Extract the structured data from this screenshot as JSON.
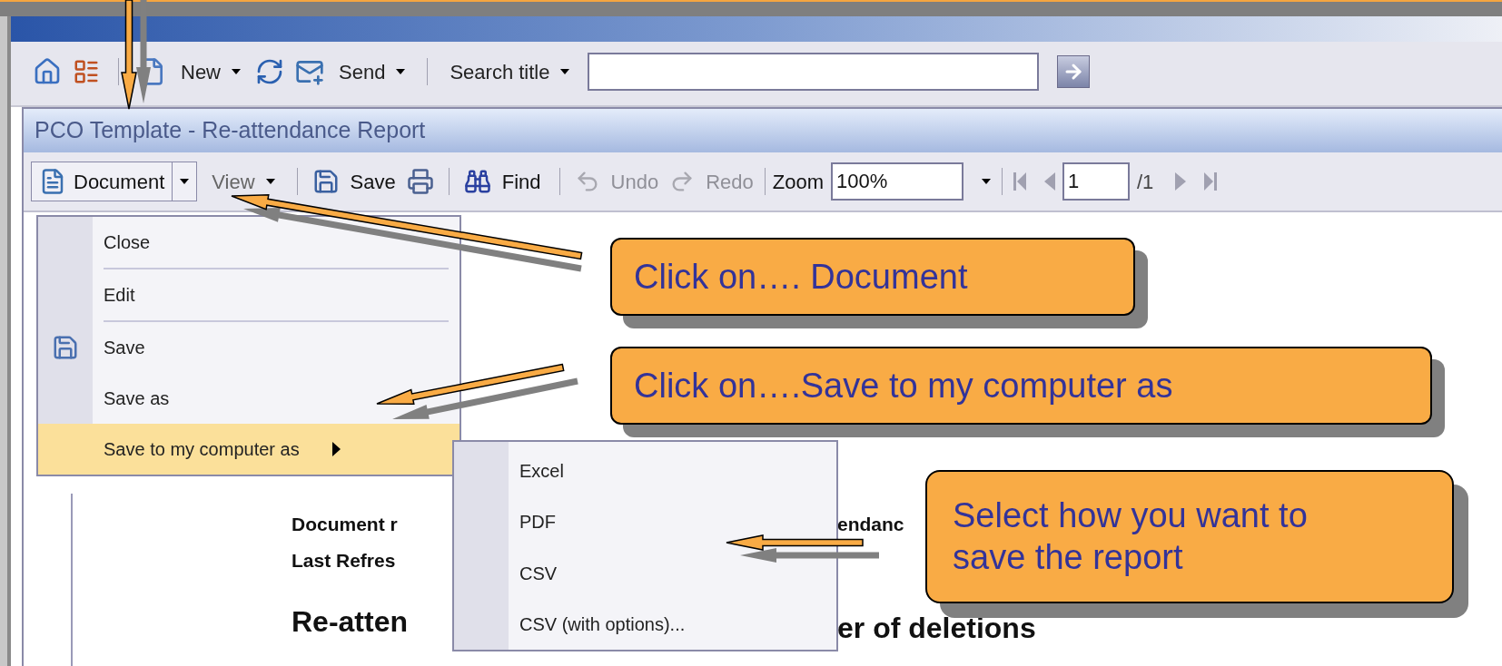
{
  "toolbar": {
    "new": "New",
    "send": "Send",
    "search_label": "Search title"
  },
  "report_window": {
    "title": "PCO Template - Re-attendance Report",
    "toolbar": {
      "document": {
        "label": "Document",
        "open": true
      },
      "view": "View",
      "save": "Save",
      "find": "Find",
      "undo": {
        "label": "Undo",
        "disabled": true
      },
      "redo": {
        "label": "Redo",
        "disabled": true
      },
      "zoom_label": "Zoom",
      "zoom_value": "100%",
      "page_value": "1",
      "page_total": "/1"
    },
    "report": {
      "left": [
        "Document r",
        "Last Refres"
      ],
      "heading_left": "Re-atten",
      "right": "endanc",
      "heading_right": "er of deletions"
    }
  },
  "document_menu": [
    {
      "label": "Close",
      "kind": "plain",
      "selected": false,
      "divider_after": true,
      "submenu": false
    },
    {
      "label": "Edit",
      "kind": "plain",
      "selected": false,
      "divider_after": true,
      "submenu": false
    },
    {
      "label": "Save",
      "kind": "with_icon",
      "selected": false,
      "divider_after": false,
      "submenu": false
    },
    {
      "label": "Save as",
      "kind": "plain",
      "selected": false,
      "divider_after": false,
      "submenu": false
    },
    {
      "label": "Save to my computer as",
      "kind": "plain",
      "selected": true,
      "divider_after": false,
      "submenu": true
    }
  ],
  "save_formats": [
    {
      "label": "Excel",
      "selected": false
    },
    {
      "label": "PDF",
      "selected": false
    },
    {
      "label": "CSV",
      "selected": false
    },
    {
      "label": "CSV (with options)...",
      "selected": false
    }
  ],
  "callouts": [
    {
      "text": "Click on…. Document"
    },
    {
      "text": "Click on….Save to my computer as"
    },
    {
      "text": "Select how you want to save the report"
    }
  ]
}
